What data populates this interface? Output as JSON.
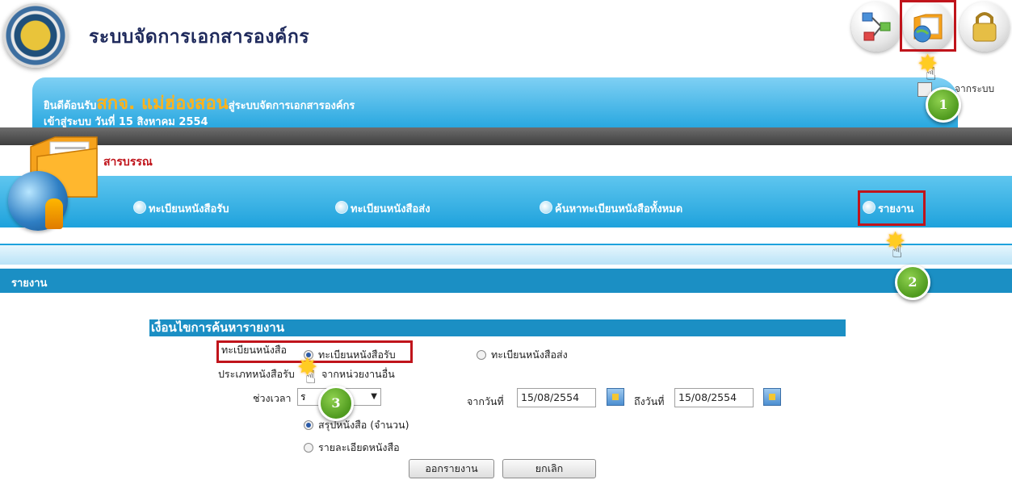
{
  "header": {
    "app_title": "ระบบจัดการเอกสารองค์กร"
  },
  "welcome": {
    "prefix": "ยินดีต้อนรับ",
    "org_name": "สกจ. แม่ฮ่องสอน",
    "suffix": "สู่ระบบจัดการเอกสารองค์กร",
    "login_line": "เข้าสู่ระบบ วันที่ 15 สิงหาคม 2554",
    "logout_partial": "จากระบบ"
  },
  "section": {
    "name": "สารบรรณ"
  },
  "nav": {
    "items": [
      {
        "label": "ทะเบียนหนังสือรับ"
      },
      {
        "label": "ทะเบียนหนังสือส่ง"
      },
      {
        "label": "ค้นหาทะเบียนหนังสือทั้งหมด"
      },
      {
        "label": "รายงาน"
      }
    ]
  },
  "page": {
    "band_title": "รายงาน"
  },
  "form": {
    "title": "เงื่อนไขการค้นหารายงาน",
    "register_label": "ทะเบียนหนังสือ",
    "register_options": [
      {
        "label": "ทะเบียนหนังสือรับ",
        "selected": true
      },
      {
        "label": "ทะเบียนหนังสือส่ง",
        "selected": false
      }
    ],
    "type_label": "ประเภทหนังสือรับ",
    "type_value": "จากหน่วยงานอื่น",
    "period_label": "ช่วงเวลา",
    "period_value": "ร",
    "from_label": "จากวันที่",
    "from_value": "15/08/2554",
    "to_label": "ถึงวันที่",
    "to_value": "15/08/2554",
    "report_options": [
      {
        "label": "สรุปหนังสือ (จำนวน)",
        "selected": true
      },
      {
        "label": "รายละเอียดหนังสือ",
        "selected": false
      }
    ],
    "submit_label": "ออกรายงาน",
    "cancel_label": "ยกเลิก"
  },
  "annotations": {
    "steps": [
      "1",
      "2",
      "3"
    ]
  },
  "colors": {
    "accent_blue": "#1ea2dc",
    "highlight_red": "#c0141b",
    "step_green": "#4f9a1e",
    "org_orange": "#ffb21a"
  },
  "icons": [
    "org-seal-logo",
    "workflow-icon",
    "folder-globe-icon",
    "lock-icon",
    "logout-icon",
    "calendar-icon",
    "globe-icon",
    "hand-pointer-icon"
  ]
}
